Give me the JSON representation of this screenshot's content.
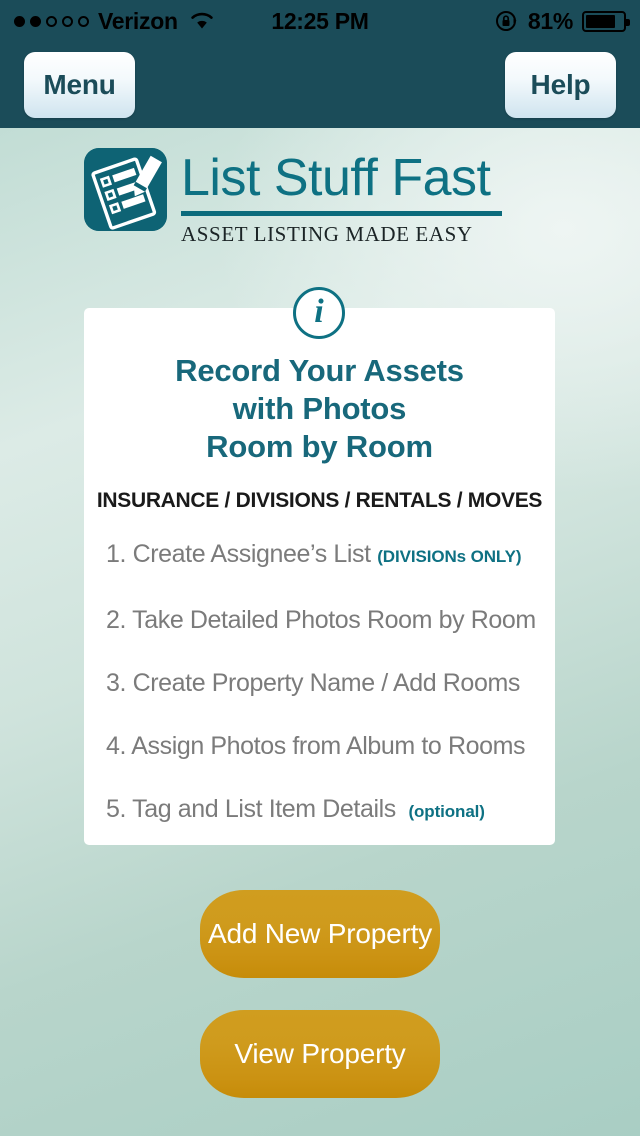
{
  "status_bar": {
    "carrier": "Verizon",
    "signal_dots_filled": 2,
    "signal_dots_total": 5,
    "wifi_icon": "wifi-icon",
    "time": "12:25 PM",
    "rotation_lock_icon": "rotation-lock-icon",
    "battery_percent": "81%",
    "battery_level": 81
  },
  "nav_bar": {
    "menu_label": "Menu",
    "help_label": "Help"
  },
  "brand": {
    "logo_icon": "clipboard-checklist-pencil-icon",
    "title": "List Stuff Fast",
    "tagline": "ASSET LISTING MADE EASY"
  },
  "card": {
    "info_icon": "info-icon",
    "info_glyph": "i",
    "heading_line1": "Record Your Assets",
    "heading_line2": "with Photos",
    "heading_line3": "Room by Room",
    "subheading": "INSURANCE / DIVISIONS / RENTALS / MOVES",
    "steps": [
      {
        "text": "1. Create Assignee’s List",
        "note": "(DIVISIONs ONLY)"
      },
      {
        "text": "2. Take Detailed Photos Room by Room",
        "note": ""
      },
      {
        "text": "3. Create Property Name / Add Rooms",
        "note": ""
      },
      {
        "text": "4. Assign Photos from Album to Rooms",
        "note": ""
      },
      {
        "text": "5. Tag and List Item Details",
        "note": "(optional)"
      }
    ]
  },
  "actions": {
    "add_property_label": "Add New Property",
    "view_property_label": "View Property"
  },
  "colors": {
    "status_bar_bg": "#1b4c59",
    "brand_teal": "#0e7183",
    "logo_teal": "#0e6374",
    "heading_teal": "#18687b",
    "button_gold": "#cb9212",
    "card_white": "#ffffff",
    "page_bg_bottom": "#a9cec4",
    "step_gray": "#7b7b7b"
  }
}
